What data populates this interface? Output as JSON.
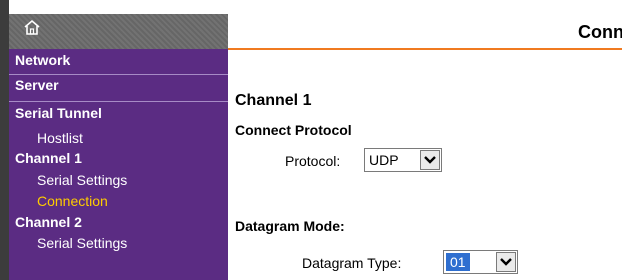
{
  "sidebar": {
    "items": [
      {
        "label": "Network",
        "type": "section"
      },
      {
        "label": "Server",
        "type": "section"
      },
      {
        "label": "Serial Tunnel",
        "type": "section"
      },
      {
        "label": "Hostlist",
        "type": "sub"
      },
      {
        "label": "Channel 1",
        "type": "section"
      },
      {
        "label": "Serial Settings",
        "type": "sub"
      },
      {
        "label": "Connection",
        "type": "sub",
        "active": true
      },
      {
        "label": "Channel 2",
        "type": "section"
      },
      {
        "label": "Serial Settings",
        "type": "sub"
      }
    ],
    "active_color": "#ffcc00",
    "bg_color": "#5b2c83"
  },
  "main": {
    "title": "Conn",
    "channel_heading": "Channel 1",
    "connect_protocol_heading": "Connect Protocol",
    "protocol_label": "Protocol:",
    "protocol_value": "UDP",
    "datagram_mode_heading": "Datagram Mode:",
    "datagram_type_label": "Datagram Type:",
    "datagram_type_value": "01",
    "accent_color": "#f07a20"
  }
}
